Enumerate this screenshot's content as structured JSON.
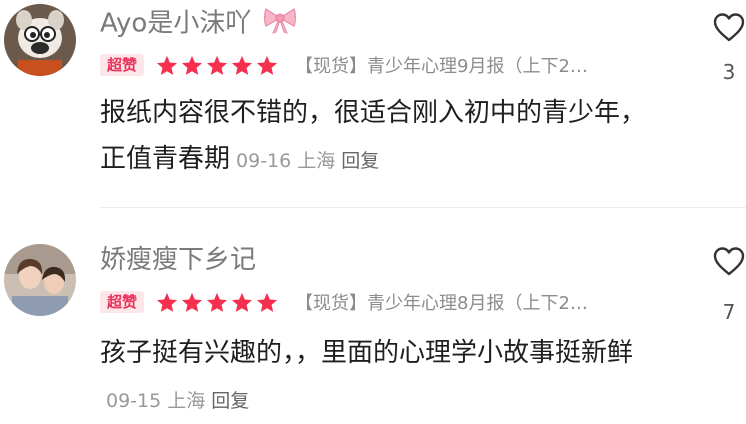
{
  "comments": [
    {
      "username": "Ayo是小沫吖",
      "badge": "超赞",
      "rating_stars": 5,
      "product": "【现货】青少年心理9月报（上下2…",
      "text": "报纸内容很不错的，很适合刚入初中的青少年，正值青春期",
      "date": "09-16",
      "location": "上海",
      "reply_label": "回复",
      "likes": "3"
    },
    {
      "username": "娇瘦瘦下乡记",
      "badge": "超赞",
      "rating_stars": 5,
      "product": "【现货】青少年心理8月报（上下2…",
      "text": "孩子挺有兴趣的，，里面的心理学小故事挺新鲜",
      "date": "09-15",
      "location": "上海",
      "reply_label": "回复",
      "likes": "7"
    }
  ],
  "colors": {
    "star": "#f4304e",
    "badge_text": "#e8335b",
    "badge_bg": "#fde6ea",
    "username": "#7a7a7a",
    "muted": "#999999"
  },
  "icons": {
    "like": "heart-outline-icon",
    "star": "star-icon",
    "bow": "pink-bow-icon"
  }
}
